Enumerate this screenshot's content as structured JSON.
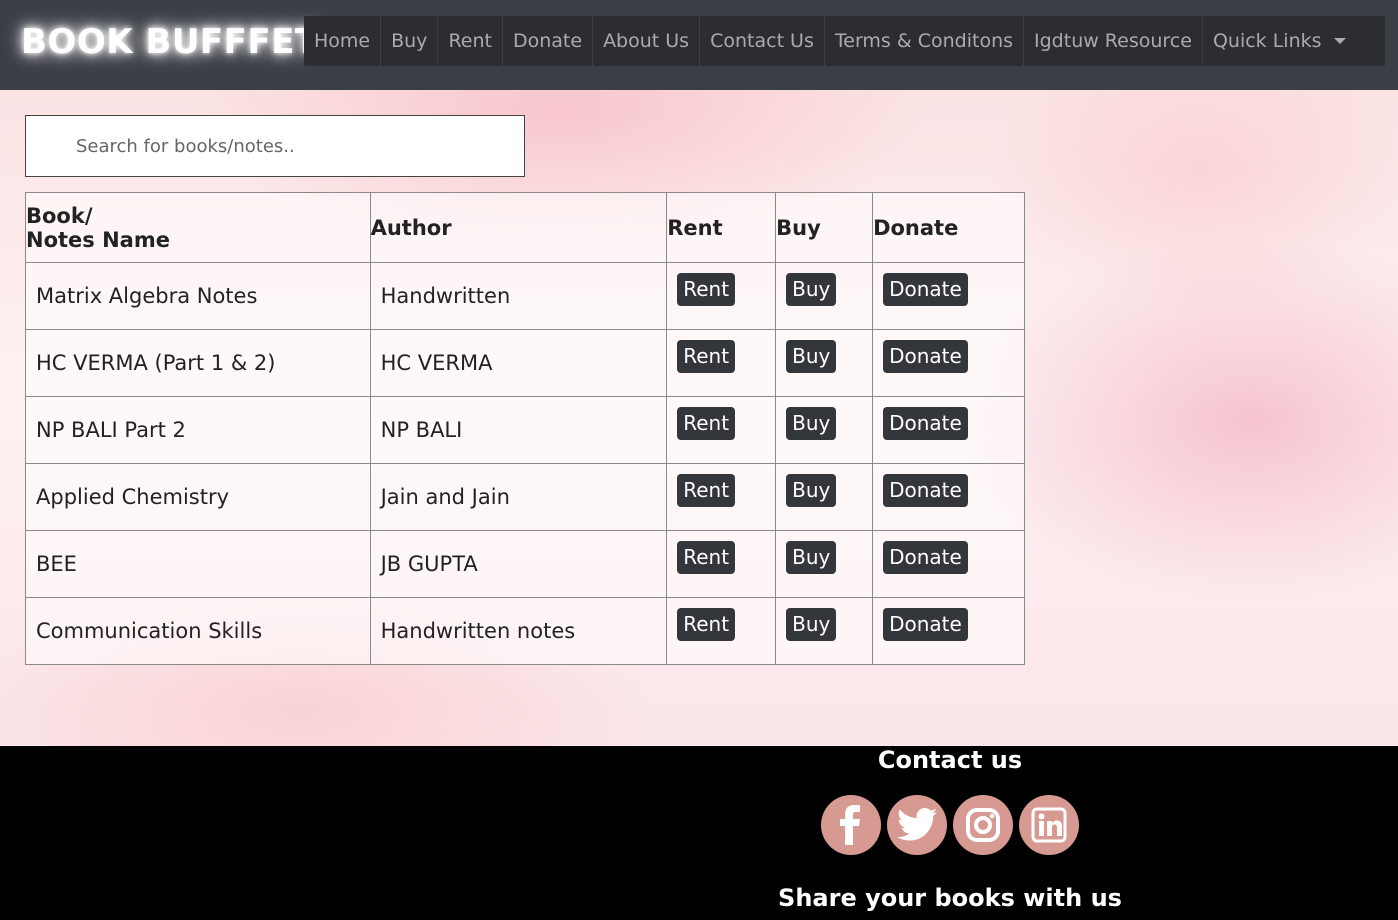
{
  "brand": "BOOK BUFFFET",
  "nav": {
    "items": [
      "Home",
      "Buy",
      "Rent",
      "Donate",
      "About Us",
      "Contact Us",
      "Terms & Conditons",
      "Igdtuw Resource"
    ],
    "dropdown_label": "Quick Links"
  },
  "search": {
    "placeholder": "Search for books/notes..",
    "value": ""
  },
  "table": {
    "headers": {
      "name_line1": "Book/",
      "name_line2": "Notes Name",
      "author": "Author",
      "rent": "Rent",
      "buy": "Buy",
      "donate": "Donate"
    },
    "rows": [
      {
        "name": "Matrix Algebra Notes",
        "author": "Handwritten"
      },
      {
        "name": "HC VERMA (Part 1 & 2)",
        "author": "HC VERMA"
      },
      {
        "name": "NP BALI Part 2",
        "author": "NP BALI"
      },
      {
        "name": "Applied Chemistry",
        "author": "Jain and Jain"
      },
      {
        "name": "BEE",
        "author": "JB GUPTA"
      },
      {
        "name": "Communication Skills",
        "author": "Handwritten notes"
      }
    ],
    "button_labels": {
      "rent": "Rent",
      "buy": "Buy",
      "donate": "Donate"
    }
  },
  "footer": {
    "contact_title": "Contact us",
    "socials": [
      "facebook-icon",
      "twitter-icon",
      "instagram-icon",
      "linkedin-icon"
    ],
    "share_title": "Share your books with us"
  },
  "colors": {
    "nav_bg": "#3a3e45",
    "button_bg": "#33363b",
    "social_bg": "#d79a92",
    "footer_bg": "#000000"
  }
}
